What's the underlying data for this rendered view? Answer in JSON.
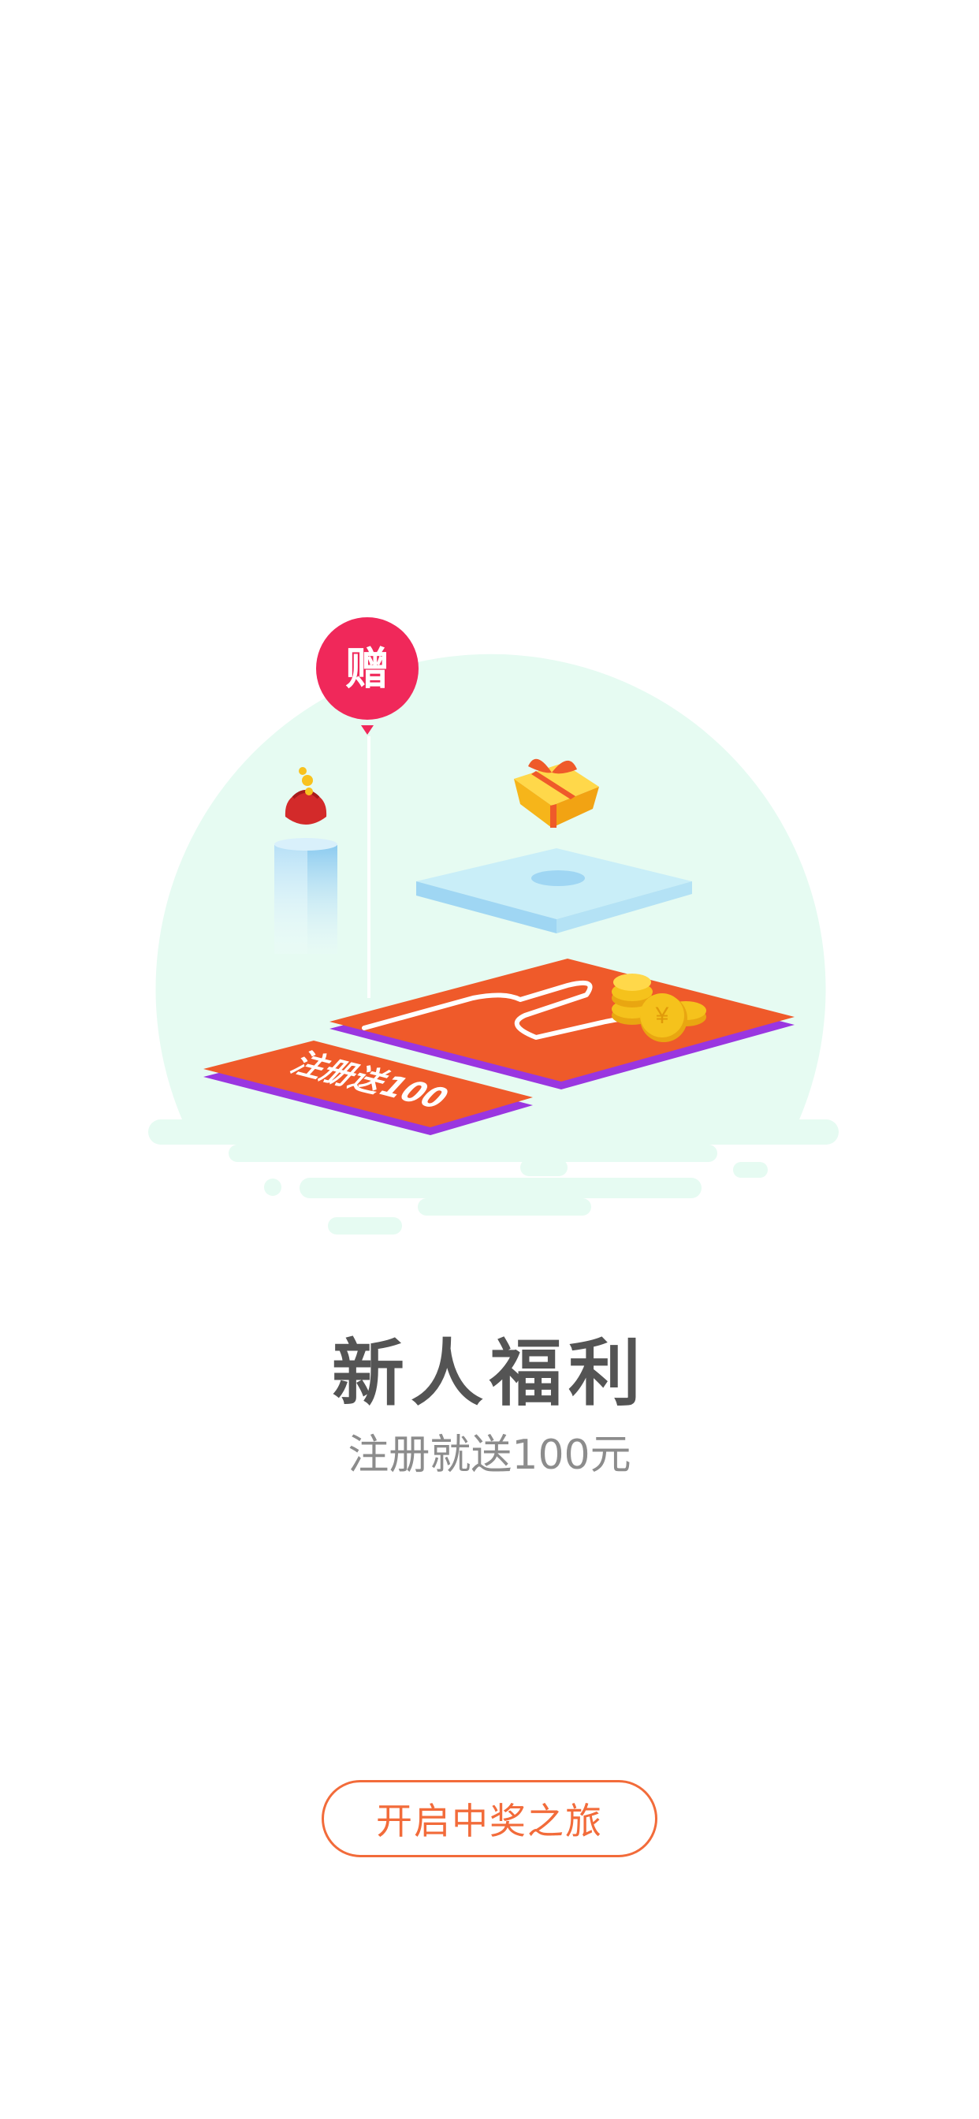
{
  "illustration": {
    "balloon_text": "赠",
    "card_text": "注册送100",
    "colors": {
      "background_circle": "#e6fbf2",
      "balloon": "#f0285a",
      "card": "#ef5a2a",
      "card_edge": "#9a36e0",
      "pillar": "#9fd6f3",
      "platform": "#c9eef8",
      "gift": "#f7c21a",
      "coin": "#f5c21c"
    }
  },
  "promo": {
    "title": "新人福利",
    "subtitle": "注册就送100元"
  },
  "cta": {
    "label": "开启中奖之旅",
    "color": "#f26b3a"
  }
}
